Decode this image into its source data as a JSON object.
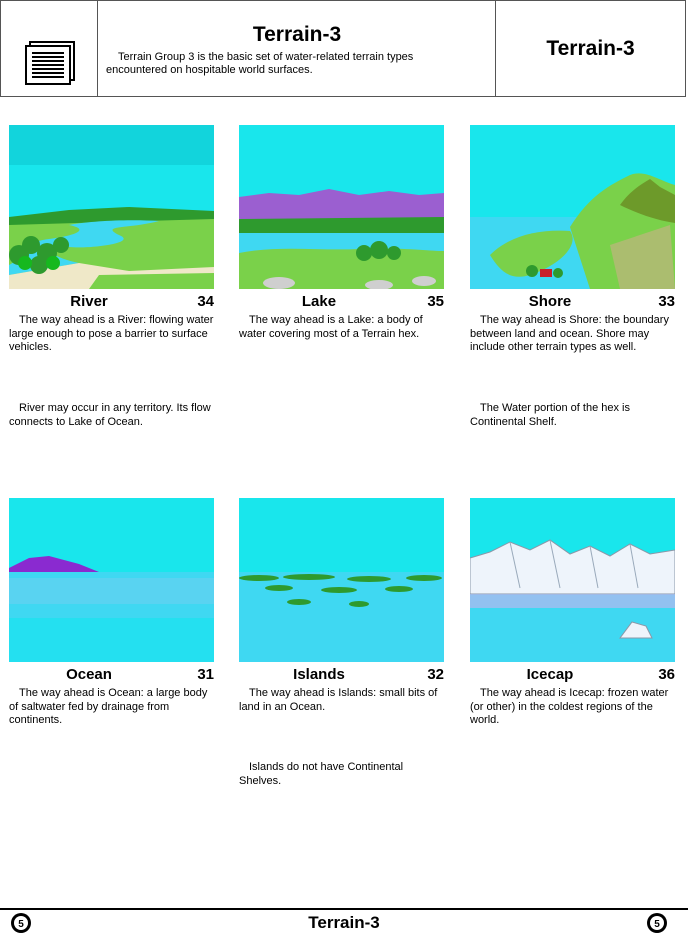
{
  "header": {
    "title": "Terrain-3",
    "description": "Terrain Group 3 is the basic set of water-related terrain types encountered on hospitable world surfaces.",
    "right_title": "Terrain-3",
    "icon": "document-icon"
  },
  "cards": [
    {
      "name": "River",
      "number": "34",
      "description": "The way ahead is a River: flowing water large enough to pose a barrier to surface vehicles.",
      "note": "River may occur in any territory. Its flow connects to Lake of Ocean."
    },
    {
      "name": "Lake",
      "number": "35",
      "description": "The way ahead is a Lake: a body of water covering most of a Terrain hex.",
      "note": ""
    },
    {
      "name": "Shore",
      "number": "33",
      "description": "The way ahead is Shore: the boundary between land and ocean. Shore may include other terrain types as well.",
      "note": "The Water portion of the hex is Continental Shelf."
    },
    {
      "name": "Ocean",
      "number": "31",
      "description": "The way ahead is Ocean: a large body of saltwater fed by drainage from continents.",
      "note": ""
    },
    {
      "name": "Islands",
      "number": "32",
      "description": "The way ahead is Islands: small bits of land in an Ocean.",
      "note": "Islands do not have Continental Shelves."
    },
    {
      "name": "Icecap",
      "number": "36",
      "description": "The way ahead is Icecap: frozen water (or other) in the coldest regions of the world.",
      "note": ""
    }
  ],
  "footer": {
    "title": "Terrain-3",
    "badge_left": "5",
    "badge_right": "5"
  },
  "colors": {
    "sky": "#19e6ec",
    "water": "#3fd8f2",
    "grass": "#7ad14a",
    "dark_grass": "#2e9a2e",
    "purple_hills": "#9b5fd0"
  }
}
